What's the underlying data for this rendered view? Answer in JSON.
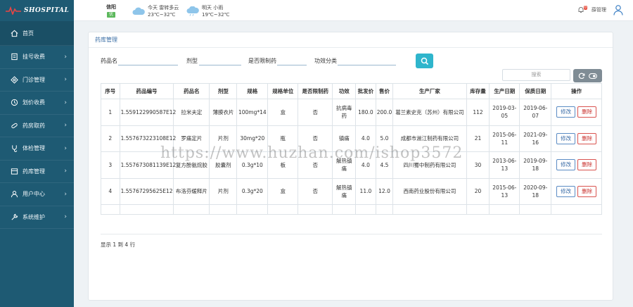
{
  "app": {
    "logo_text": "SHOSPITAL"
  },
  "sidebar": {
    "items": [
      {
        "label": "首页",
        "icon": "home-icon"
      },
      {
        "label": "挂号收费",
        "icon": "register-icon"
      },
      {
        "label": "门诊管理",
        "icon": "outpatient-icon"
      },
      {
        "label": "划价收费",
        "icon": "pricing-icon"
      },
      {
        "label": "药房取药",
        "icon": "pharmacy-icon"
      },
      {
        "label": "体检管理",
        "icon": "checkup-icon"
      },
      {
        "label": "药库管理",
        "icon": "warehouse-icon"
      },
      {
        "label": "用户中心",
        "icon": "user-icon"
      },
      {
        "label": "系统维护",
        "icon": "tools-icon"
      }
    ]
  },
  "header": {
    "city": "信阳",
    "aqi": "优",
    "today_label": "今天",
    "today_weather": "雷转多云",
    "today_temp": "23℃~32℃",
    "tomorrow_label": "明天",
    "tomorrow_weather": "小雨",
    "tomorrow_temp": "19℃~32℃",
    "notification_count": "0",
    "admin_name": "薛管理"
  },
  "page": {
    "title": "药库管理"
  },
  "search": {
    "name_label": "药品名",
    "type_label": "剂型",
    "restricted_label": "是否限制药",
    "effect_label": "功效分类",
    "table_search_placeholder": "搜索"
  },
  "table": {
    "headers": [
      "序号",
      "药品编号",
      "药品名",
      "剂型",
      "规格",
      "规格单位",
      "是否限制药",
      "功效",
      "批发价",
      "售价",
      "生产厂家",
      "库存量",
      "生产日期",
      "保质日期",
      "操作"
    ],
    "rows": [
      {
        "no": "1",
        "code": "1.559122990587E12",
        "name": "拉米夫定",
        "form": "薄膜衣片",
        "spec": "100mg*14",
        "unit": "盒",
        "restricted": "否",
        "effect": "抗病毒药",
        "wholesale": "180.0",
        "price": "200.0",
        "maker": "葛兰素史克（苏州）有限公司",
        "stock": "112",
        "prod_date": "2019-03-05",
        "expiry": "2019-06-07"
      },
      {
        "no": "2",
        "code": "1.557673223108E12",
        "name": "罗痛定片",
        "form": "片剂",
        "spec": "30mg*20",
        "unit": "瓶",
        "restricted": "否",
        "effect": "镇痛",
        "wholesale": "4.0",
        "price": "5.0",
        "maker": "成都市湔江制药有限公司",
        "stock": "21",
        "prod_date": "2015-06-11",
        "expiry": "2021-09-16"
      },
      {
        "no": "3",
        "code": "1.557673081139E12",
        "name": "复方酚氨烷胶",
        "form": "胶囊剂",
        "spec": "0.3g*10",
        "unit": "板",
        "restricted": "否",
        "effect": "解热镇痛",
        "wholesale": "4.0",
        "price": "4.5",
        "maker": "四川蜀中制药有限公司",
        "stock": "30",
        "prod_date": "2013-06-13",
        "expiry": "2019-09-18"
      },
      {
        "no": "4",
        "code": "1.55767295625E12",
        "name": "布洛芬缓释片",
        "form": "片剂",
        "spec": "0.3g*20",
        "unit": "盒",
        "restricted": "否",
        "effect": "解热镇痛",
        "wholesale": "11.0",
        "price": "12.0",
        "maker": "西南药业股份有限公司",
        "stock": "20",
        "prod_date": "2015-06-13",
        "expiry": "2020-09-18"
      }
    ],
    "edit_label": "修改",
    "delete_label": "删除"
  },
  "pager": {
    "summary": "显示 1 到 4 行"
  },
  "watermark": "https://www.huzhan.com/ishop3572",
  "colors": {
    "sidebar": "#1e5a73",
    "accent": "#2fb5cc",
    "title": "#3a6ea5",
    "danger": "#d9534f"
  }
}
